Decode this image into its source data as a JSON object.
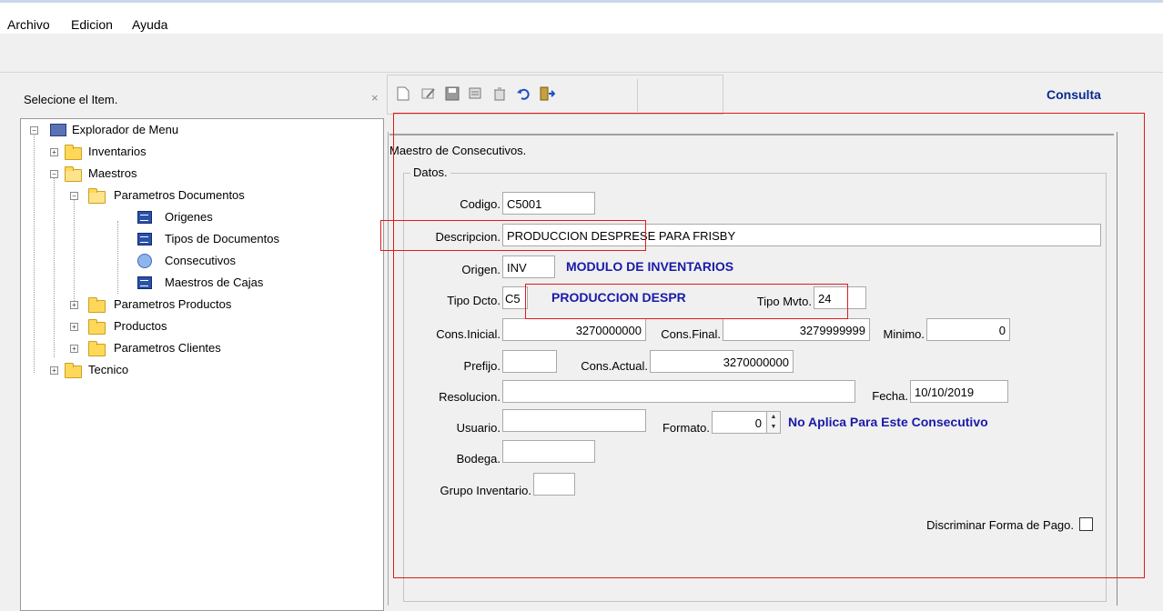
{
  "menu": {
    "items": [
      "Archivo",
      "Edicion",
      "Ayuda"
    ]
  },
  "left_panel": {
    "title": "Selecione el Item.",
    "close_glyph": "×",
    "tree": [
      {
        "label": "Explorador de Menu",
        "icon": "computer-icon"
      },
      {
        "label": "Inventarios",
        "icon": "folder-icon"
      },
      {
        "label": "Maestros",
        "icon": "folder-open-icon"
      },
      {
        "label": "Parametros Documentos",
        "icon": "folder-open-icon"
      },
      {
        "label": "Origenes",
        "icon": "form-icon"
      },
      {
        "label": "Tipos de Documentos",
        "icon": "form-icon"
      },
      {
        "label": "Consecutivos",
        "icon": "globe-icon"
      },
      {
        "label": "Maestros de Cajas",
        "icon": "form-icon"
      },
      {
        "label": "Parametros Productos",
        "icon": "folder-icon"
      },
      {
        "label": "Productos",
        "icon": "folder-icon"
      },
      {
        "label": "Parametros Clientes",
        "icon": "folder-icon"
      },
      {
        "label": "Tecnico",
        "icon": "folder-icon"
      }
    ]
  },
  "toolbar": {
    "buttons": [
      "new-icon",
      "edit-icon",
      "save-icon",
      "search-icon",
      "delete-icon",
      "undo-icon",
      "exit-icon"
    ]
  },
  "mode_label": "Consulta",
  "form": {
    "title": "Maestro de Consecutivos.",
    "group_title": "Datos.",
    "labels": {
      "codigo": "Codigo.",
      "descripcion": "Descripcion.",
      "origen": "Origen.",
      "tipo_dcto": "Tipo Dcto.",
      "tipo_mvto": "Tipo Mvto.",
      "cons_inicial": "Cons.Inicial.",
      "cons_final": "Cons.Final.",
      "minimo": "Minimo.",
      "prefijo": "Prefijo.",
      "cons_actual": "Cons.Actual.",
      "resolucion": "Resolucion.",
      "fecha": "Fecha.",
      "usuario": "Usuario.",
      "formato": "Formato.",
      "bodega": "Bodega.",
      "grupo_inventario": "Grupo Inventario.",
      "discriminar": "Discriminar Forma de Pago."
    },
    "values": {
      "codigo": "C5001",
      "descripcion": "PRODUCCION DESPRESE PARA FRISBY",
      "origen": "INV",
      "origen_desc": "MODULO DE INVENTARIOS",
      "tipo_dcto": "C5",
      "tipo_dcto_desc": "PRODUCCION DESPR",
      "tipo_mvto": "24",
      "cons_inicial": "3270000000",
      "cons_final": "3279999999",
      "minimo": "0",
      "prefijo": "",
      "cons_actual": "3270000000",
      "resolucion": "",
      "fecha": "10/10/2019",
      "usuario": "",
      "formato": "0",
      "formato_desc": "No Aplica Para Este Consecutivo",
      "bodega": "",
      "grupo_inventario": ""
    },
    "discriminar_checked": false
  },
  "colors": {
    "accent_blue": "#1a1aa8",
    "highlight_red": "#e01a1a"
  }
}
